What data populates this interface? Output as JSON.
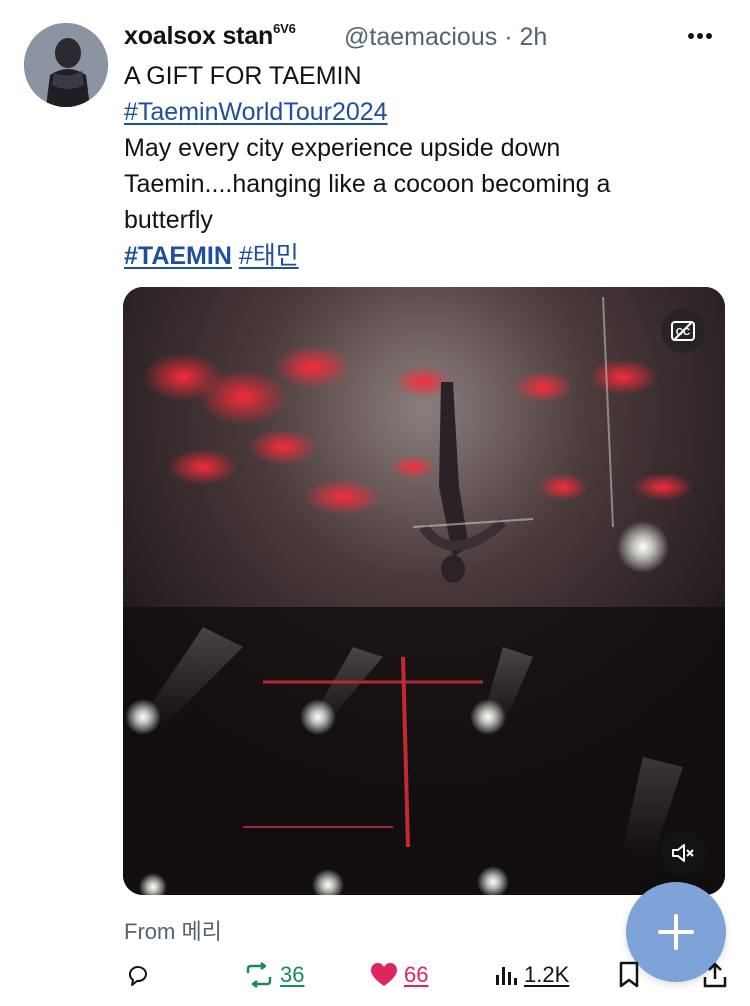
{
  "tweet": {
    "display_name": "xoalsox stan",
    "name_suffix": "6V6",
    "handle": "@taemacious",
    "time": "· 2h",
    "lines": [
      "A GIFT FOR TAEMIN",
      "#TaeminWorldTour2024",
      "May every city experience upside down",
      "Taemin....hanging like a cocoon becoming a",
      "butterfly"
    ],
    "hashtag_bold": "#TAEMIN",
    "hashtag_korean": "#태민",
    "from_label": "From 메리"
  },
  "media": {
    "type": "video",
    "muted": true
  },
  "stats": {
    "retweets": "36",
    "likes": "66",
    "views": "1.2K"
  },
  "icons": {
    "more": "more-horizontal-icon",
    "captions": "closed-captions-off-icon",
    "mute": "speaker-muted-icon",
    "reply": "reply-bubble-icon",
    "retweet": "retweet-icon",
    "like": "heart-filled-icon",
    "views": "analytics-bars-icon",
    "bookmark": "bookmark-icon",
    "share": "share-icon",
    "compose": "plus-icon"
  },
  "colors": {
    "link": "#1d4f9c",
    "retweet": "#1a8a5a",
    "like": "#e0245e",
    "fab": "#7ea3d9"
  }
}
